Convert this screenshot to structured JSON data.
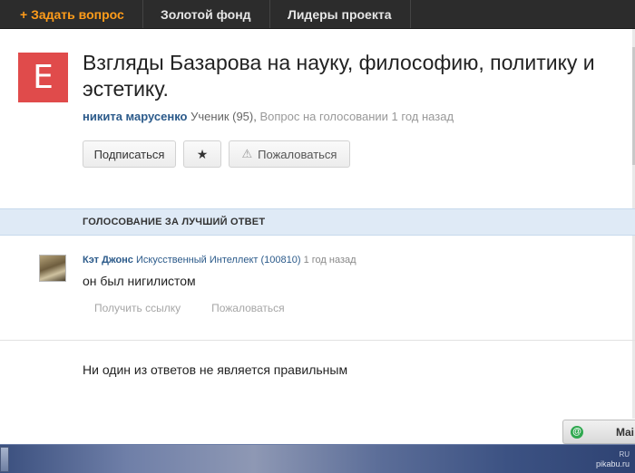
{
  "nav": {
    "ask_label": "+ Задать вопрос",
    "gold_label": "Золотой фонд",
    "leaders_label": "Лидеры проекта"
  },
  "question": {
    "avatar_letter": "E",
    "avatar_color": "#e04b4b",
    "title": "Взгляды Базарова на науку, философию, политику и эстетику.",
    "author": "никита марусенко",
    "rank": "Ученик (95),",
    "status": "Вопрос на голосовании 1 год назад"
  },
  "actions": {
    "subscribe_label": "Подписаться",
    "star_label": "★",
    "report_label": "Пожаловаться"
  },
  "voting": {
    "banner_label": "ГОЛОСОВАНИЕ ЗА ЛУЧШИЙ ОТВЕТ"
  },
  "answer": {
    "name": "Кэт Джонс",
    "rank": "Искусственный Интеллект (100810)",
    "time": "1 год назад",
    "text": "он был нигилистом",
    "get_link_label": "Получить ссылку",
    "report_label": "Пожаловаться"
  },
  "footer_option": {
    "text": "Ни один из ответов не является правильным"
  },
  "mail_widget": {
    "icon": "at-icon",
    "label": "Mai"
  },
  "watermark": {
    "small": "RU",
    "text": "pikabu.ru"
  }
}
